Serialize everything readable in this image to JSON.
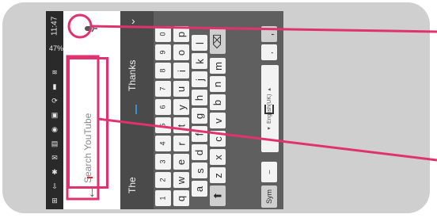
{
  "status_bar": {
    "time": "11:47",
    "battery": "47%"
  },
  "app": {
    "search_placeholder": "Search YouTube",
    "mic_icon": "mic-icon",
    "back_icon": "arrow-back-icon"
  },
  "keyboard": {
    "suggestions": [
      "The",
      "I",
      "Thanks"
    ],
    "language_label": "◂ English(UK) ▸",
    "rows": {
      "numbers": [
        "1",
        "2",
        "3",
        "4",
        "5",
        "6",
        "7",
        "8",
        "9",
        "0"
      ],
      "row1": [
        "q",
        "w",
        "e",
        "r",
        "t",
        "y",
        "u",
        "i",
        "o",
        "p"
      ],
      "row2": [
        "a",
        "s",
        "d",
        "f",
        "g",
        "h",
        "j",
        "k",
        "l"
      ],
      "row3": [
        "z",
        "x",
        "c",
        "v",
        "b",
        "n",
        "m"
      ],
      "row4_left": "Sym",
      "row4_dot": ".",
      "row4_comma": ",",
      "shift_icon": "shift-icon",
      "backspace_icon": "backspace-icon"
    }
  },
  "colors": {
    "highlight": "#e0336e"
  }
}
